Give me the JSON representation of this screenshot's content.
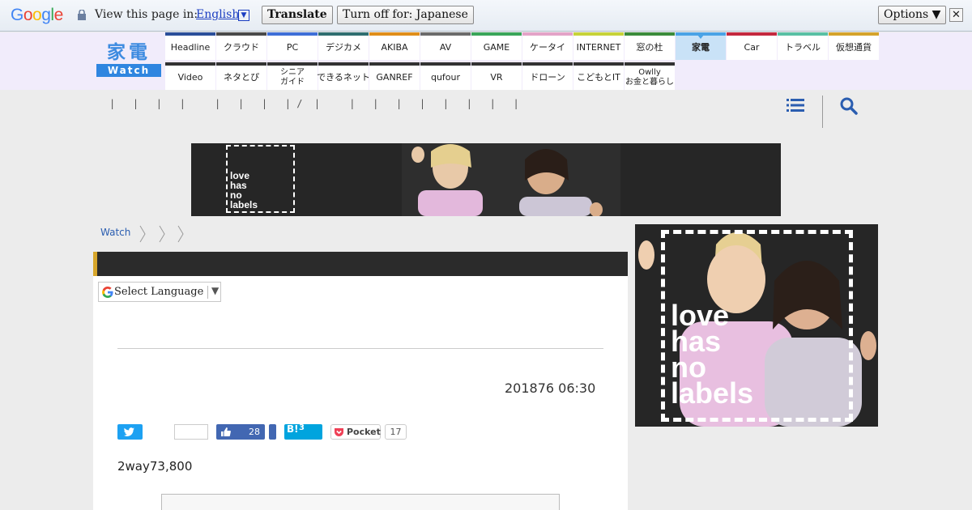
{
  "translate_bar": {
    "logo": "Google",
    "view_text": "View this page in:",
    "language": "English",
    "translate_label": "Translate",
    "turn_off_label": "Turn off for: Japanese",
    "options_label": "Options ▼",
    "close_label": "✕"
  },
  "site": {
    "logo_top": "家電",
    "logo_bottom": "Watch"
  },
  "nav": {
    "row1": [
      {
        "label": "Headline",
        "color": "#2a4f9a"
      },
      {
        "label": "クラウド",
        "color": "#4a4a4a"
      },
      {
        "label": "PC",
        "color": "#3e6fd8"
      },
      {
        "label": "デジカメ",
        "color": "#2f6e70"
      },
      {
        "label": "AKIBA",
        "color": "#e08e1a"
      },
      {
        "label": "AV",
        "color": "#6b6b6b"
      },
      {
        "label": "GAME",
        "color": "#3aa55a"
      },
      {
        "label": "ケータイ",
        "color": "#e3a3c8"
      },
      {
        "label": "INTERNET",
        "color": "#c7d33a"
      },
      {
        "label": "窓の杜",
        "color": "#3b8c3b"
      },
      {
        "label": "家電",
        "color": "#4aa3e6",
        "active": true
      },
      {
        "label": "Car",
        "color": "#c4283e"
      },
      {
        "label": "トラベル",
        "color": "#59c0a4"
      },
      {
        "label": "仮想通貨",
        "color": "#d4a32b"
      }
    ],
    "row2": [
      {
        "label": "Video",
        "color": "#333333"
      },
      {
        "label": "ネタとぴ",
        "color": "#333333"
      },
      {
        "label": "シニア\nガイド",
        "color": "#333333"
      },
      {
        "label": "できるネット",
        "color": "#333333"
      },
      {
        "label": "GANREF",
        "color": "#333333"
      },
      {
        "label": "qufour",
        "color": "#333333"
      },
      {
        "label": "VR",
        "color": "#333333"
      },
      {
        "label": "ドローン",
        "color": "#333333"
      },
      {
        "label": "こどもとIT",
        "color": "#333333"
      },
      {
        "label": "Owlly\nお金と暮らし",
        "color": "#333333"
      }
    ]
  },
  "subnav_pipes": "|   |   |   |     |   |   |   | /  |     |   |   |   |   |   |   |   |",
  "ads": {
    "banner_text": "love\nhas\nno\nlabels",
    "side_text": "love\nhas\nno\nlabels"
  },
  "breadcrumb": {
    "home": "Watch"
  },
  "article": {
    "language_select": "Select Language",
    "date": "201876 06:30",
    "facebook_count": "28",
    "hatena_label": "B!",
    "hatena_count": "3",
    "pocket_label": "Pocket",
    "pocket_count": "17",
    "lead": "2way73,800"
  }
}
